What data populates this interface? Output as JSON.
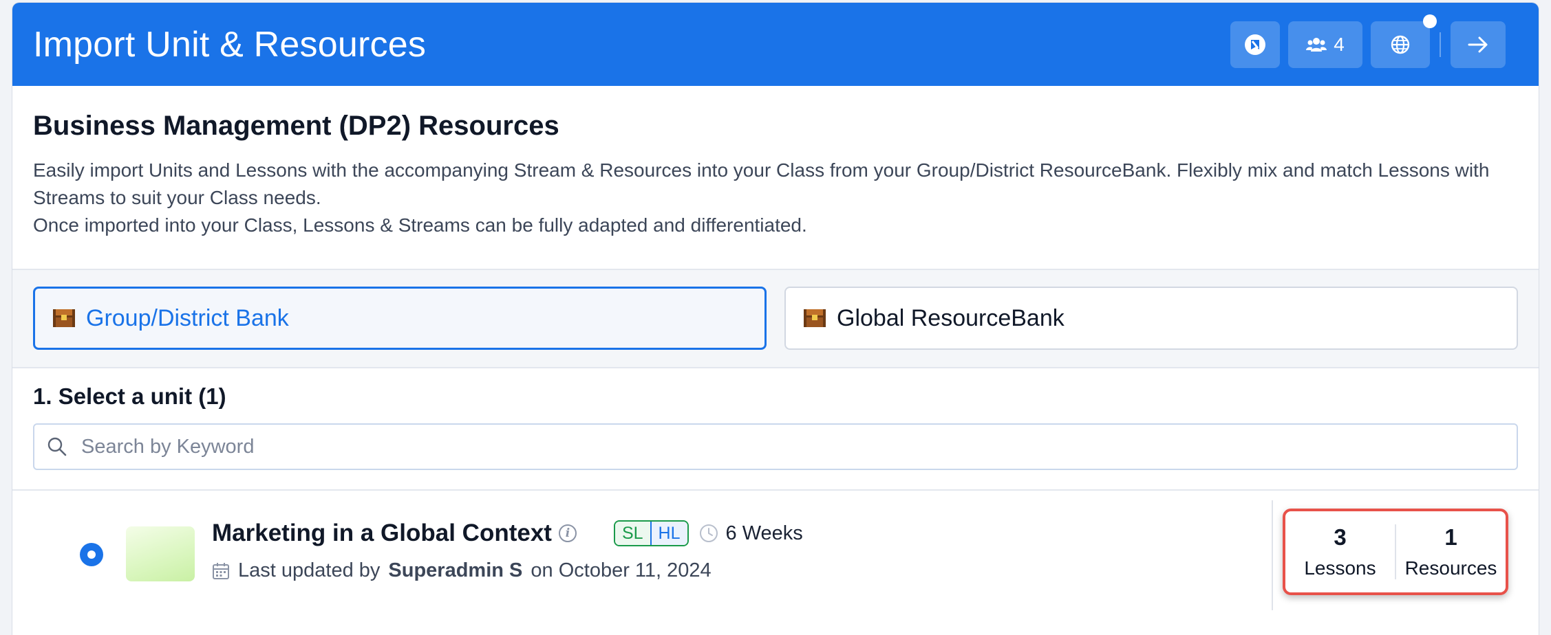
{
  "header": {
    "title": "Import Unit & Resources",
    "users_count": "4"
  },
  "intro": {
    "title": "Business Management (DP2) Resources",
    "line1": "Easily import Units and Lessons with the accompanying Stream & Resources into your Class from your Group/District ResourceBank. Flexibly mix and match Lessons with Streams to suit your Class needs.",
    "line2": "Once imported into your Class, Lessons & Streams can be fully adapted and differentiated."
  },
  "banks": [
    {
      "label": "Group/District Bank",
      "active": true
    },
    {
      "label": "Global ResourceBank",
      "active": false
    }
  ],
  "select": {
    "title": "1. Select a unit (1)",
    "search_placeholder": "Search by Keyword"
  },
  "unit": {
    "title": "Marketing in a Global Context",
    "levels": [
      "SL",
      "HL"
    ],
    "duration": "6 Weeks",
    "updated_prefix": "Last updated by",
    "updated_by": "Superadmin S",
    "updated_on": "on October 11, 2024",
    "lessons_count": "3",
    "lessons_label": "Lessons",
    "resources_count": "1",
    "resources_label": "Resources"
  },
  "colors": {
    "primary": "#1a73e8",
    "highlight_border": "#e8524a",
    "sl_green": "#1a9a4a"
  },
  "icons": [
    "chat-icon",
    "users-icon",
    "globe-icon",
    "arrow-right-icon",
    "chest-icon",
    "search-icon",
    "info-icon",
    "clock-icon",
    "calendar-icon"
  ]
}
